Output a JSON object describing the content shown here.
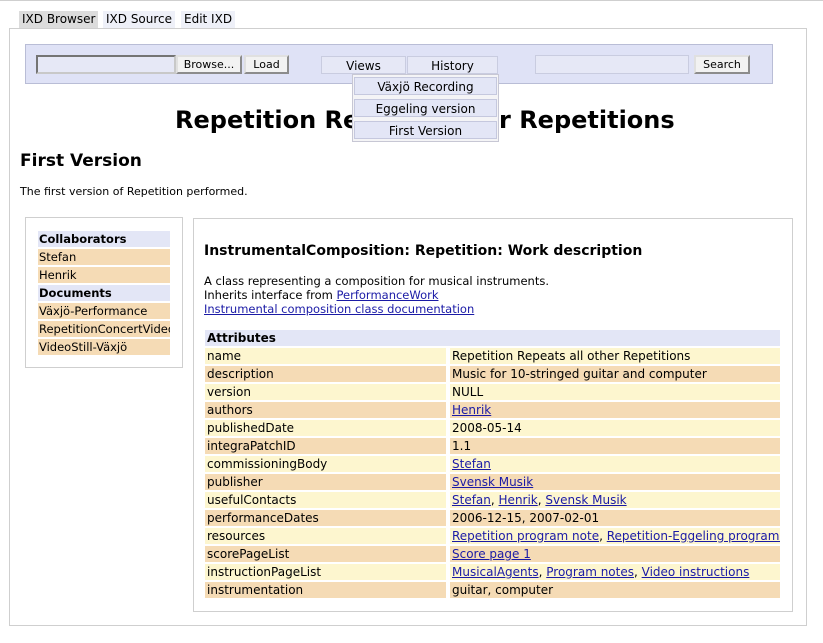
{
  "tabs": [
    "IXD Browser",
    "IXD Source",
    "Edit IXD"
  ],
  "toolbar": {
    "file_value": "",
    "browse_label": "Browse...",
    "load_label": "Load",
    "views_label": "Views",
    "history_label": "History",
    "search_value": "",
    "search_label": "Search"
  },
  "history_menu": [
    "Växjö Recording",
    "Eggeling version",
    "First Version"
  ],
  "page": {
    "title_left": "Repetition Repe",
    "title_right": "r Repetitions",
    "subtitle": "First Version",
    "description": "The first version of Repetition performed."
  },
  "sidebar": {
    "collaborators_heading": "Collaborators",
    "collaborators": [
      "Stefan",
      "Henrik"
    ],
    "documents_heading": "Documents",
    "documents": [
      "Växjö-Performance",
      "RepetitionConcertVideo",
      "VideoStill-Växjö"
    ]
  },
  "main": {
    "title": "InstrumentalComposition: Repetition: Work description",
    "class_desc": "A class representing a composition for musical instruments.",
    "inherits_prefix": "Inherits interface from",
    "inherits_link": "PerformanceWork",
    "doc_link": "Instrumental composition class documentation",
    "attributes_heading": "Attributes",
    "attributes": [
      {
        "key": "name",
        "value": "Repetition Repeats all other Repetitions"
      },
      {
        "key": "description",
        "value": "Music for 10-stringed guitar and computer"
      },
      {
        "key": "version",
        "value": "NULL"
      },
      {
        "key": "authors",
        "links": [
          "Henrik"
        ]
      },
      {
        "key": "publishedDate",
        "value": "2008-05-14"
      },
      {
        "key": "integraPatchID",
        "value": "1.1"
      },
      {
        "key": "commissioningBody",
        "links": [
          "Stefan"
        ]
      },
      {
        "key": "publisher",
        "links": [
          "Svensk Musik"
        ]
      },
      {
        "key": "usefulContacts",
        "links": [
          "Stefan",
          "Henrik",
          "Svensk Musik"
        ]
      },
      {
        "key": "performanceDates",
        "value": "2006-12-15, 2007-02-01"
      },
      {
        "key": "resources",
        "links": [
          "Repetition program note",
          "Repetition-Eggeling program note"
        ]
      },
      {
        "key": "scorePageList",
        "links": [
          "Score page 1"
        ]
      },
      {
        "key": "instructionPageList",
        "links": [
          "MusicalAgents",
          "Program notes",
          "Video instructions"
        ]
      },
      {
        "key": "instrumentation",
        "value": "guitar, computer"
      }
    ]
  }
}
